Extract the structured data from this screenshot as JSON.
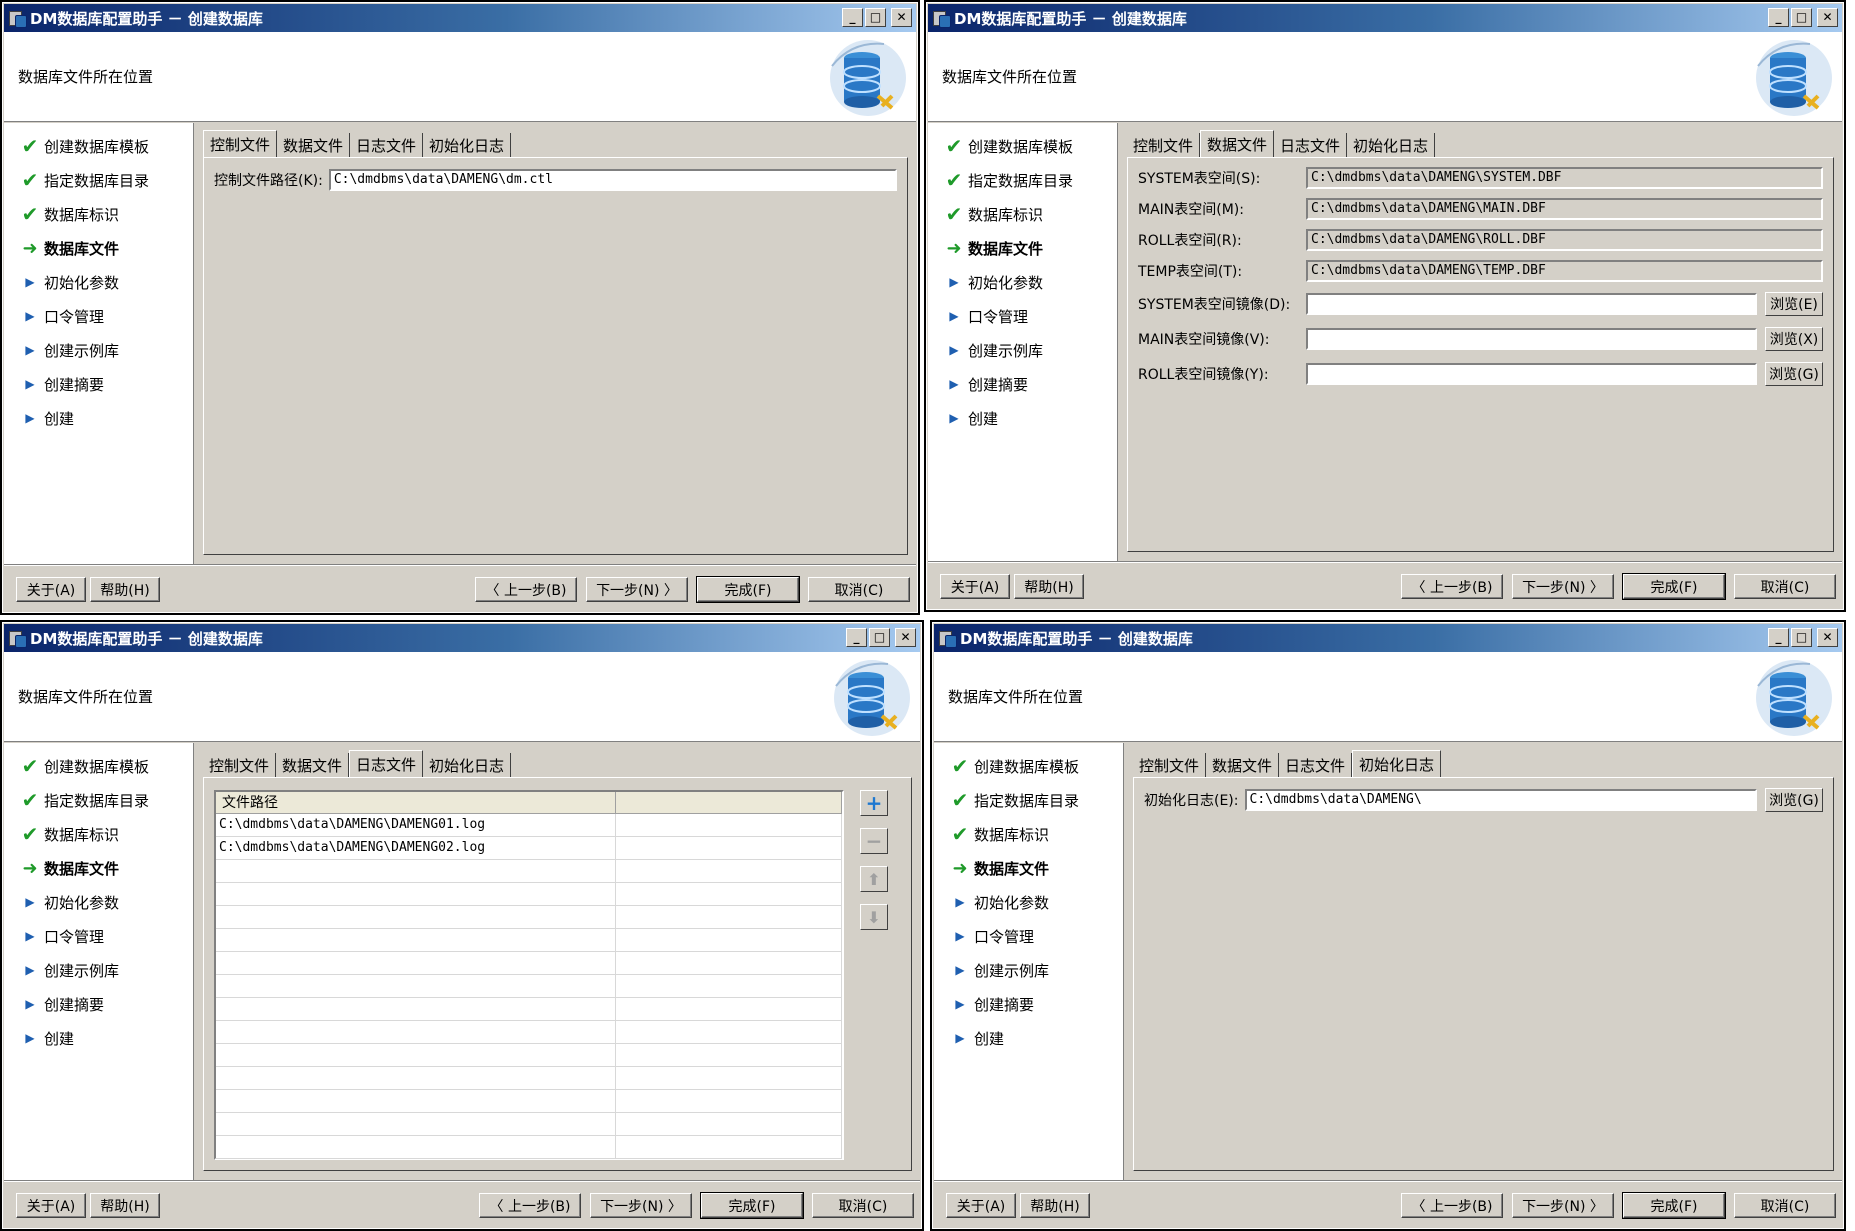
{
  "title": "DM数据库配置助手 － 创建数据库",
  "window_controls": [
    "_",
    "□",
    "✕"
  ],
  "header_title": "数据库文件所在位置",
  "steps": [
    {
      "label": "创建数据库模板",
      "state": "done"
    },
    {
      "label": "指定数据库目录",
      "state": "done"
    },
    {
      "label": "数据库标识",
      "state": "done"
    },
    {
      "label": "数据库文件",
      "state": "current"
    },
    {
      "label": "初始化参数",
      "state": "todo"
    },
    {
      "label": "口令管理",
      "state": "todo"
    },
    {
      "label": "创建示例库",
      "state": "todo"
    },
    {
      "label": "创建摘要",
      "state": "todo"
    },
    {
      "label": "创建",
      "state": "todo"
    }
  ],
  "tabs": [
    "控制文件",
    "数据文件",
    "日志文件",
    "初始化日志"
  ],
  "footer": {
    "about": "关于(A)",
    "help": "帮助(H)",
    "prev": "〈 上一步(B)",
    "next": "下一步(N) 〉",
    "finish": "完成(F)",
    "cancel": "取消(C)"
  },
  "panel_control": {
    "label": "控制文件路径(K):",
    "value": "C:\\dmdbms\\data\\DAMENG\\dm.ctl"
  },
  "panel_data": {
    "rows": [
      {
        "label": "SYSTEM表空间(S):",
        "value": "C:\\dmdbms\\data\\DAMENG\\SYSTEM.DBF"
      },
      {
        "label": "MAIN表空间(M):",
        "value": "C:\\dmdbms\\data\\DAMENG\\MAIN.DBF"
      },
      {
        "label": "ROLL表空间(R):",
        "value": "C:\\dmdbms\\data\\DAMENG\\ROLL.DBF"
      },
      {
        "label": "TEMP表空间(T):",
        "value": "C:\\dmdbms\\data\\DAMENG\\TEMP.DBF"
      }
    ],
    "mirrors": [
      {
        "label": "SYSTEM表空间镜像(D):",
        "value": "",
        "browse": "浏览(E)"
      },
      {
        "label": "MAIN表空间镜像(V):",
        "value": "",
        "browse": "浏览(X)"
      },
      {
        "label": "ROLL表空间镜像(Y):",
        "value": "",
        "browse": "浏览(G)"
      }
    ]
  },
  "panel_log": {
    "column": "文件路径",
    "rows": [
      "C:\\dmdbms\\data\\DAMENG\\DAMENG01.log",
      "C:\\dmdbms\\data\\DAMENG\\DAMENG02.log"
    ]
  },
  "panel_initlog": {
    "label": "初始化日志(E):",
    "value": "C:\\dmdbms\\data\\DAMENG\\",
    "browse": "浏览(G)"
  }
}
